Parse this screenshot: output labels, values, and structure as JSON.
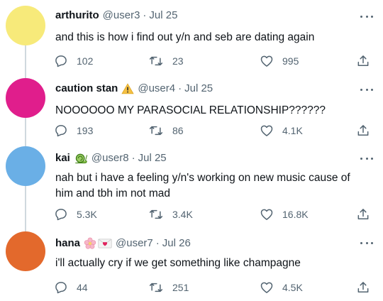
{
  "tweets": [
    {
      "name": "arthurito",
      "handle": "@user3",
      "separator": "·",
      "date": "Jul 25",
      "text": "and this is how i find out y/n and seb are dating again",
      "replies": "102",
      "retweets": "23",
      "likes": "995",
      "avatar_color": "#f7ea7a",
      "badge": null
    },
    {
      "name": "caution stan",
      "handle": "@user4",
      "separator": "·",
      "date": "Jul 25",
      "text": "NOOOOOO MY PARASOCIAL RELATIONSHIP??????",
      "replies": "193",
      "retweets": "86",
      "likes": "4.1K",
      "avatar_color": "#e01e8c",
      "badge": "warning-sign-icon"
    },
    {
      "name": "kai",
      "handle": "@user8",
      "separator": "·",
      "date": "Jul 25",
      "text": "nah but i have a feeling y/n's working on new music cause of him and tbh im not mad",
      "replies": "5.3K",
      "retweets": "3.4K",
      "likes": "16.8K",
      "avatar_color": "#6aafe6",
      "badge": "snail-emoji-icon"
    },
    {
      "name": "hana",
      "handle": "@user7",
      "separator": "·",
      "date": "Jul 26",
      "text": "i'll actually cry if we get something like champagne",
      "replies": "44",
      "retweets": "251",
      "likes": "4.5K",
      "avatar_color": "#e3692c",
      "badge": "blossom-and-love-letter-emoji-icons"
    }
  ],
  "colors": {
    "text": "#0f1419",
    "secondary": "#536471",
    "connector": "#cfd9de"
  }
}
